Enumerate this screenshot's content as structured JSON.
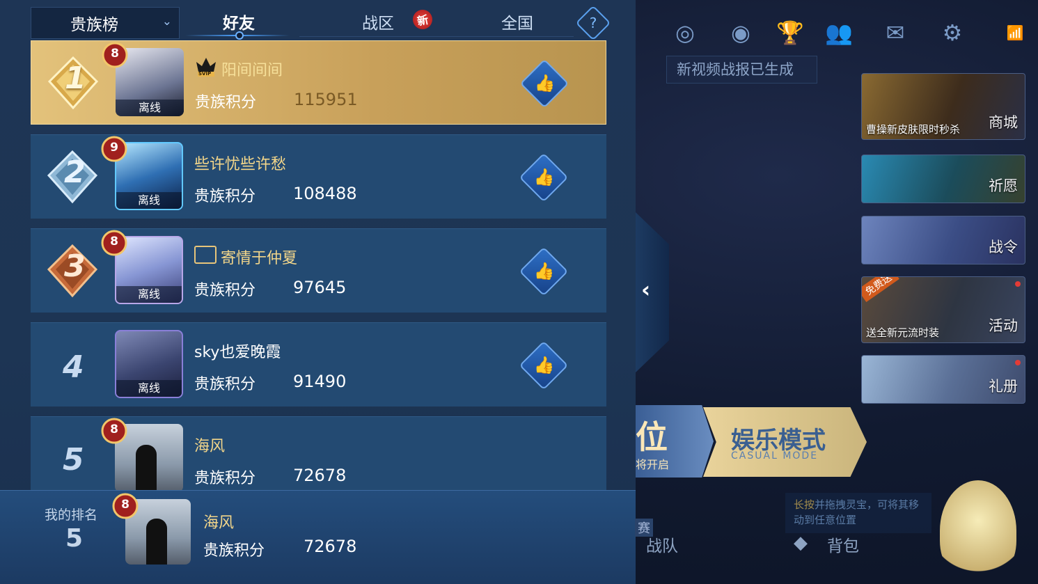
{
  "tabs": {
    "dropdown_label": "贵族榜",
    "friends": "好友",
    "zone": "战区",
    "zone_badge": "新",
    "national": "全国",
    "help": "?"
  },
  "rows": [
    {
      "rank": "1",
      "level": "8",
      "name": "阳间间间",
      "score_label": "贵族积分",
      "score": "115951",
      "status": "离线"
    },
    {
      "rank": "2",
      "level": "9",
      "name": "些许忧些许愁",
      "score_label": "贵族积分",
      "score": "108488",
      "status": "离线"
    },
    {
      "rank": "3",
      "level": "8",
      "name": "寄情于仲夏",
      "score_label": "贵族积分",
      "score": "97645",
      "status": "离线"
    },
    {
      "rank": "4",
      "level": "",
      "name": "sky也爱晚霞",
      "score_label": "贵族积分",
      "score": "91490",
      "status": "离线"
    },
    {
      "rank": "5",
      "level": "8",
      "name": "海风",
      "score_label": "贵族积分",
      "score": "72678",
      "status": ""
    }
  ],
  "svip_label": "SVIP",
  "me": {
    "label": "我的排名",
    "rank": "5",
    "level": "8",
    "name": "海风",
    "score_label": "贵族积分",
    "score": "72678"
  },
  "lobby": {
    "video_notice": "新视频战报已生成",
    "cards": [
      {
        "label": "商城",
        "caption": "曹操新皮肤限时秒杀"
      },
      {
        "label": "祈愿",
        "caption": ""
      },
      {
        "label": "战令",
        "caption": ""
      },
      {
        "label": "活动",
        "caption": "送全新元流时装",
        "ribbon": "免费送"
      },
      {
        "label": "礼册",
        "caption": ""
      }
    ],
    "ranked_big": "位",
    "ranked_small": "将开启",
    "casual_title": "娱乐模式",
    "casual_sub": "CASUAL MODE",
    "tip_highlight": "长按",
    "tip_rest": "并拖拽灵宝，可将其移动到任意位置",
    "team": "战队",
    "bag": "背包",
    "race": "赛"
  },
  "colors": {
    "gold_name": "#f3d68a",
    "panel_bg": "#1d3554",
    "row_bg": "#234a72",
    "first_row": "#d8b56e"
  }
}
